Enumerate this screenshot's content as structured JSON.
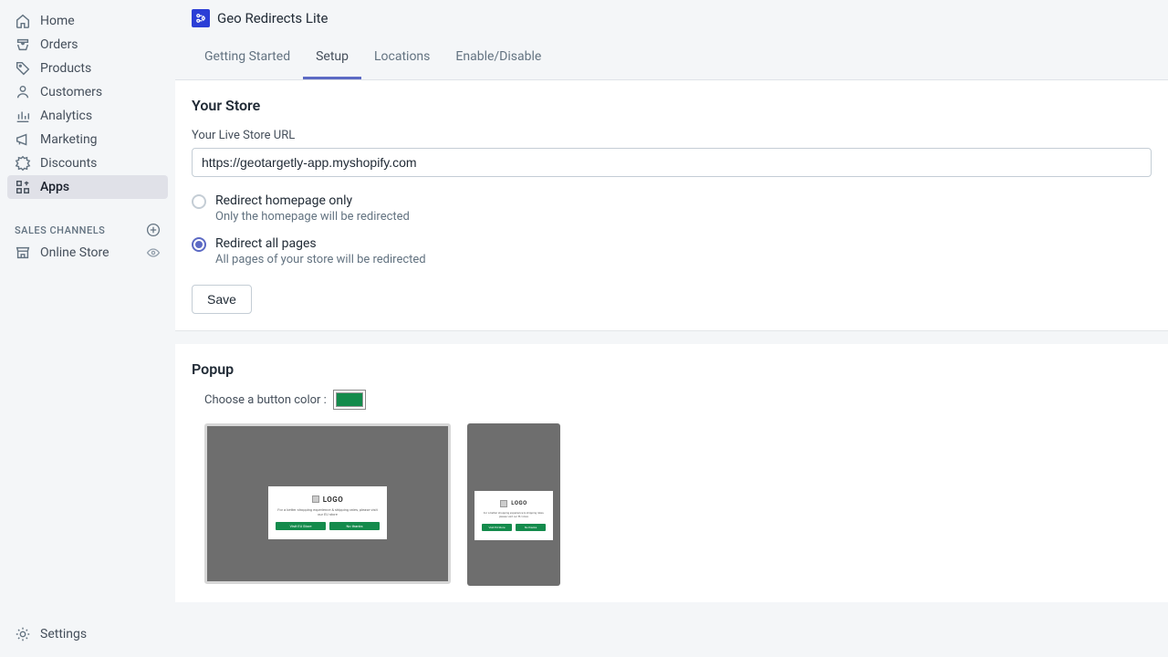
{
  "sidebar": {
    "items": [
      {
        "label": "Home"
      },
      {
        "label": "Orders"
      },
      {
        "label": "Products"
      },
      {
        "label": "Customers"
      },
      {
        "label": "Analytics"
      },
      {
        "label": "Marketing"
      },
      {
        "label": "Discounts"
      },
      {
        "label": "Apps"
      }
    ],
    "channels_title": "SALES CHANNELS",
    "channels": [
      {
        "label": "Online Store"
      }
    ],
    "settings_label": "Settings"
  },
  "app": {
    "title": "Geo Redirects Lite"
  },
  "tabs": [
    {
      "label": "Getting Started"
    },
    {
      "label": "Setup"
    },
    {
      "label": "Locations"
    },
    {
      "label": "Enable/Disable"
    }
  ],
  "store": {
    "title": "Your Store",
    "url_label": "Your Live Store URL",
    "url_value": "https://geotargetly-app.myshopify.com",
    "option1_label": "Redirect homepage only",
    "option1_desc": "Only the homepage will be redirected",
    "option2_label": "Redirect all pages",
    "option2_desc": "All pages of your store will be redirected",
    "save_label": "Save"
  },
  "popup": {
    "title": "Popup",
    "color_label": "Choose a button color :",
    "button_color": "#148b4c",
    "logo_text": "LOGO",
    "message": "For a better shopping experience & shipping rates, please visit our EU store",
    "btn1": "Visit EU Store",
    "btn2": "No thanks"
  }
}
